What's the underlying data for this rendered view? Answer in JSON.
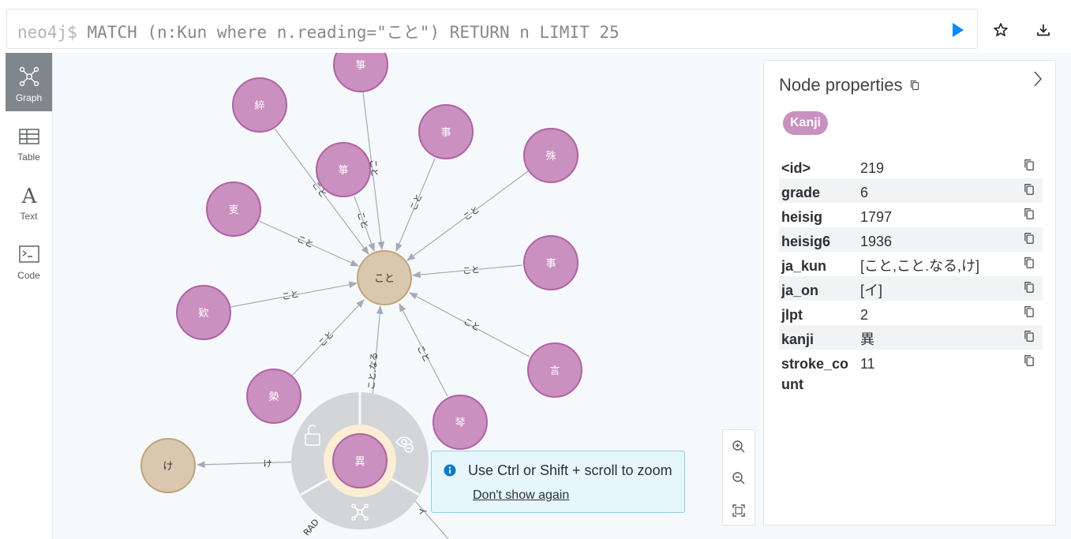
{
  "command": {
    "prompt": "neo4j$",
    "query": "MATCH (n:Kun where n.reading=\"こと\") RETURN n LIMIT 25"
  },
  "nav": {
    "graph": "Graph",
    "table": "Table",
    "text": "Text",
    "code": "Code"
  },
  "graph": {
    "center": "こと",
    "selected": "異",
    "kun_ke": "け",
    "nodes": {
      "n1": "箏",
      "n2": "綷",
      "n3": "事",
      "n4": "殊",
      "n5": "箏",
      "n6": "叓",
      "n7": "事",
      "n8": "欵",
      "n9": "言",
      "n10": "槷",
      "n11": "琴"
    },
    "rel": {
      "koto": "こと",
      "koto_naru": "こと.なる",
      "ke": "け",
      "rad": "RAD",
      "i": "イ"
    }
  },
  "properties": {
    "title": "Node properties",
    "label": "Kanji",
    "rows": [
      {
        "key": "<id>",
        "value": "219"
      },
      {
        "key": "grade",
        "value": "6"
      },
      {
        "key": "heisig",
        "value": "1797"
      },
      {
        "key": "heisig6",
        "value": "1936"
      },
      {
        "key": "ja_kun",
        "value": "[こと,こと.なる,け]"
      },
      {
        "key": "ja_on",
        "value": "[イ]"
      },
      {
        "key": "jlpt",
        "value": "2"
      },
      {
        "key": "kanji",
        "value": "異"
      },
      {
        "key": "stroke_count",
        "value": "11"
      }
    ]
  },
  "toast": {
    "message": "Use Ctrl or Shift + scroll to zoom",
    "link": "Don't show again"
  },
  "colors": {
    "kanji_node": "#c990c0",
    "kanji_border": "#b261a5",
    "kun_node": "#d9c8ae",
    "kun_border": "#c0a378",
    "accent": "#018bff"
  }
}
